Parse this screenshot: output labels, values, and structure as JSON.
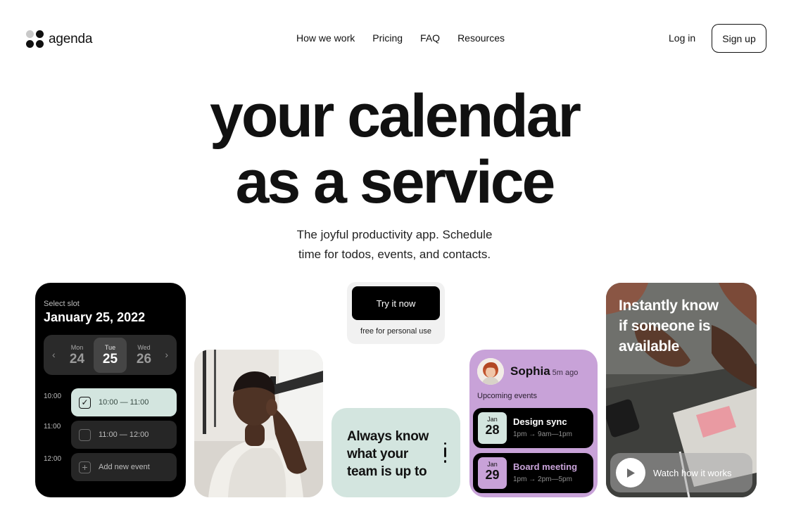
{
  "brand": {
    "name": "agenda"
  },
  "nav": {
    "items": [
      "How we work",
      "Pricing",
      "FAQ",
      "Resources"
    ]
  },
  "auth": {
    "login": "Log in",
    "signup": "Sign up"
  },
  "hero": {
    "title_line1": "your calendar",
    "title_line2": "as a service",
    "subtitle_line1": "The joyful productivity app. Schedule",
    "subtitle_line2": "time for todos, events, and contacts."
  },
  "calendar": {
    "label": "Select slot",
    "date": "January 25, 2022",
    "days": [
      {
        "name": "Mon",
        "num": "24"
      },
      {
        "name": "Tue",
        "num": "25"
      },
      {
        "name": "Wed",
        "num": "26"
      }
    ],
    "slots": [
      {
        "time": "10:00",
        "text": "10:00 — 11:00"
      },
      {
        "time": "11:00",
        "text": "11:00 — 12:00"
      },
      {
        "time": "12:00",
        "text": "Add new event"
      }
    ]
  },
  "cta": {
    "button": "Try it now",
    "note": "free for personal use"
  },
  "know_card": {
    "text_line1": "Always know",
    "text_line2": "what your",
    "text_line3": "team is up to"
  },
  "contact": {
    "name": "Sophia",
    "ago": "5m ago",
    "upcoming_label": "Upcoming events",
    "events": [
      {
        "month": "Jan",
        "day": "28",
        "title": "Design sync",
        "time": "1pm → 9am—1pm"
      },
      {
        "month": "Jan",
        "day": "29",
        "title": "Board meeting",
        "time": "1pm → 2pm—5pm"
      }
    ]
  },
  "video_card": {
    "text_line1": "Instantly know",
    "text_line2": "if someone is",
    "text_line3": "available",
    "watch_label": "Watch how it works"
  },
  "colors": {
    "mint": "#d3e5df",
    "lilac": "#c8a2d8",
    "black": "#000000",
    "event_highlight": "#c8a2d8"
  }
}
